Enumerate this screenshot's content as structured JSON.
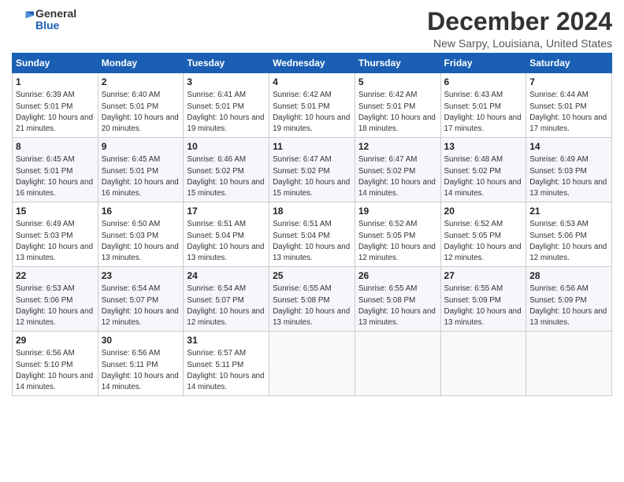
{
  "logo": {
    "general": "General",
    "blue": "Blue"
  },
  "title": "December 2024",
  "location": "New Sarpy, Louisiana, United States",
  "headers": [
    "Sunday",
    "Monday",
    "Tuesday",
    "Wednesday",
    "Thursday",
    "Friday",
    "Saturday"
  ],
  "weeks": [
    [
      {
        "day": "1",
        "sunrise": "6:39 AM",
        "sunset": "5:01 PM",
        "daylight": "10 hours and 21 minutes."
      },
      {
        "day": "2",
        "sunrise": "6:40 AM",
        "sunset": "5:01 PM",
        "daylight": "10 hours and 20 minutes."
      },
      {
        "day": "3",
        "sunrise": "6:41 AM",
        "sunset": "5:01 PM",
        "daylight": "10 hours and 19 minutes."
      },
      {
        "day": "4",
        "sunrise": "6:42 AM",
        "sunset": "5:01 PM",
        "daylight": "10 hours and 19 minutes."
      },
      {
        "day": "5",
        "sunrise": "6:42 AM",
        "sunset": "5:01 PM",
        "daylight": "10 hours and 18 minutes."
      },
      {
        "day": "6",
        "sunrise": "6:43 AM",
        "sunset": "5:01 PM",
        "daylight": "10 hours and 17 minutes."
      },
      {
        "day": "7",
        "sunrise": "6:44 AM",
        "sunset": "5:01 PM",
        "daylight": "10 hours and 17 minutes."
      }
    ],
    [
      {
        "day": "8",
        "sunrise": "6:45 AM",
        "sunset": "5:01 PM",
        "daylight": "10 hours and 16 minutes."
      },
      {
        "day": "9",
        "sunrise": "6:45 AM",
        "sunset": "5:01 PM",
        "daylight": "10 hours and 16 minutes."
      },
      {
        "day": "10",
        "sunrise": "6:46 AM",
        "sunset": "5:02 PM",
        "daylight": "10 hours and 15 minutes."
      },
      {
        "day": "11",
        "sunrise": "6:47 AM",
        "sunset": "5:02 PM",
        "daylight": "10 hours and 15 minutes."
      },
      {
        "day": "12",
        "sunrise": "6:47 AM",
        "sunset": "5:02 PM",
        "daylight": "10 hours and 14 minutes."
      },
      {
        "day": "13",
        "sunrise": "6:48 AM",
        "sunset": "5:02 PM",
        "daylight": "10 hours and 14 minutes."
      },
      {
        "day": "14",
        "sunrise": "6:49 AM",
        "sunset": "5:03 PM",
        "daylight": "10 hours and 13 minutes."
      }
    ],
    [
      {
        "day": "15",
        "sunrise": "6:49 AM",
        "sunset": "5:03 PM",
        "daylight": "10 hours and 13 minutes."
      },
      {
        "day": "16",
        "sunrise": "6:50 AM",
        "sunset": "5:03 PM",
        "daylight": "10 hours and 13 minutes."
      },
      {
        "day": "17",
        "sunrise": "6:51 AM",
        "sunset": "5:04 PM",
        "daylight": "10 hours and 13 minutes."
      },
      {
        "day": "18",
        "sunrise": "6:51 AM",
        "sunset": "5:04 PM",
        "daylight": "10 hours and 13 minutes."
      },
      {
        "day": "19",
        "sunrise": "6:52 AM",
        "sunset": "5:05 PM",
        "daylight": "10 hours and 12 minutes."
      },
      {
        "day": "20",
        "sunrise": "6:52 AM",
        "sunset": "5:05 PM",
        "daylight": "10 hours and 12 minutes."
      },
      {
        "day": "21",
        "sunrise": "6:53 AM",
        "sunset": "5:06 PM",
        "daylight": "10 hours and 12 minutes."
      }
    ],
    [
      {
        "day": "22",
        "sunrise": "6:53 AM",
        "sunset": "5:06 PM",
        "daylight": "10 hours and 12 minutes."
      },
      {
        "day": "23",
        "sunrise": "6:54 AM",
        "sunset": "5:07 PM",
        "daylight": "10 hours and 12 minutes."
      },
      {
        "day": "24",
        "sunrise": "6:54 AM",
        "sunset": "5:07 PM",
        "daylight": "10 hours and 12 minutes."
      },
      {
        "day": "25",
        "sunrise": "6:55 AM",
        "sunset": "5:08 PM",
        "daylight": "10 hours and 13 minutes."
      },
      {
        "day": "26",
        "sunrise": "6:55 AM",
        "sunset": "5:08 PM",
        "daylight": "10 hours and 13 minutes."
      },
      {
        "day": "27",
        "sunrise": "6:55 AM",
        "sunset": "5:09 PM",
        "daylight": "10 hours and 13 minutes."
      },
      {
        "day": "28",
        "sunrise": "6:56 AM",
        "sunset": "5:09 PM",
        "daylight": "10 hours and 13 minutes."
      }
    ],
    [
      {
        "day": "29",
        "sunrise": "6:56 AM",
        "sunset": "5:10 PM",
        "daylight": "10 hours and 14 minutes."
      },
      {
        "day": "30",
        "sunrise": "6:56 AM",
        "sunset": "5:11 PM",
        "daylight": "10 hours and 14 minutes."
      },
      {
        "day": "31",
        "sunrise": "6:57 AM",
        "sunset": "5:11 PM",
        "daylight": "10 hours and 14 minutes."
      },
      null,
      null,
      null,
      null
    ]
  ]
}
